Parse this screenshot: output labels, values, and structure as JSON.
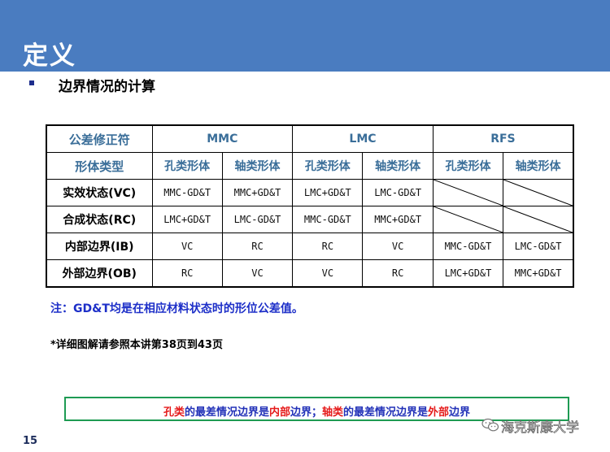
{
  "slide": {
    "title": "定义",
    "bullet": "边界情况的计算",
    "page_number": "15"
  },
  "table": {
    "corner_label": "公差修正符",
    "groups": [
      "MMC",
      "LMC",
      "RFS"
    ],
    "type_label": "形体类型",
    "sub_headers": [
      "孔类形体",
      "轴类形体",
      "孔类形体",
      "轴类形体",
      "孔类形体",
      "轴类形体"
    ],
    "rows": [
      {
        "label": "实效状态(VC)",
        "cells": [
          "MMC-GD&T",
          "MMC+GD&T",
          "LMC+GD&T",
          "LMC-GD&T",
          "",
          ""
        ]
      },
      {
        "label": "合成状态(RC)",
        "cells": [
          "LMC+GD&T",
          "LMC-GD&T",
          "MMC-GD&T",
          "MMC+GD&T",
          "",
          ""
        ]
      },
      {
        "label": "内部边界(IB)",
        "cells": [
          "VC",
          "RC",
          "RC",
          "VC",
          "MMC-GD&T",
          "LMC-GD&T"
        ]
      },
      {
        "label": "外部边界(OB)",
        "cells": [
          "RC",
          "VC",
          "VC",
          "RC",
          "LMC+GD&T",
          "MMC+GD&T"
        ]
      }
    ]
  },
  "note": "注：GD&T均是在相应材料状态时的形位公差值。",
  "reference": "*详细图解请参照本讲第38页到43页",
  "summary": {
    "p1": "孔类",
    "p2": "的最差情况边界是",
    "p3": "内部",
    "p4": "边界；",
    "p5": "轴类",
    "p6": "的最差情况边界是",
    "p7": "外部",
    "p8": "边界"
  },
  "watermark": {
    "icon": "wechat-icon",
    "text": "海克斯康大学"
  }
}
